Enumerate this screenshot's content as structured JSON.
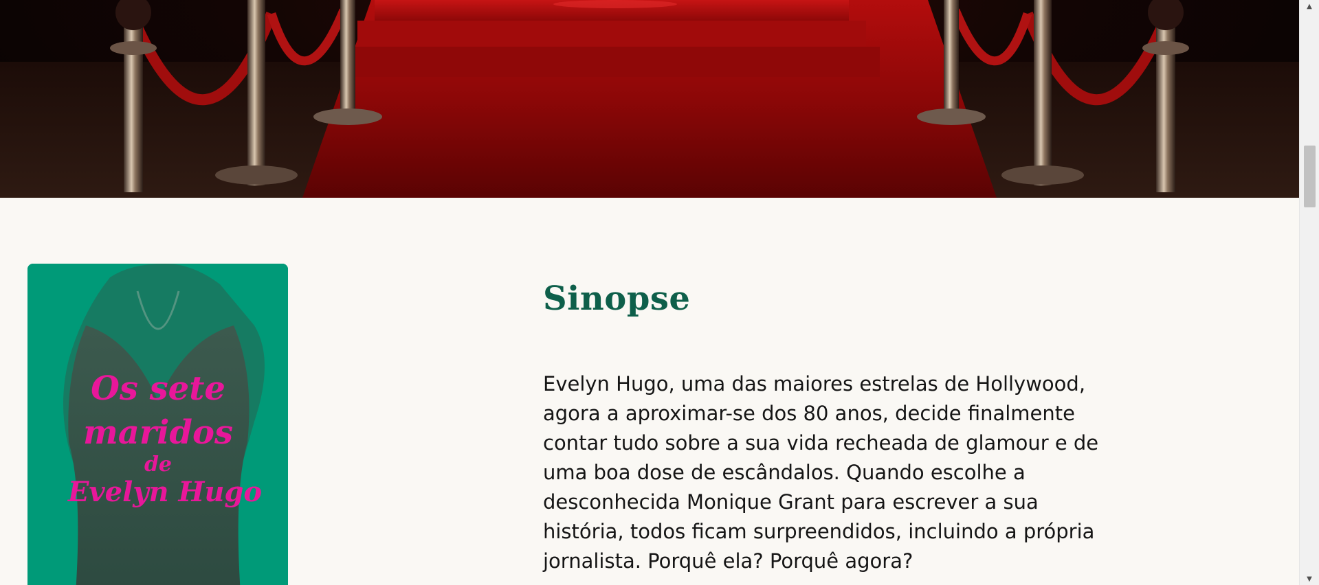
{
  "hero": {
    "image": "red-carpet-banner"
  },
  "book": {
    "cover_title_lines": [
      "Os sete",
      "maridos",
      "de",
      "Evelyn Hugo"
    ],
    "cover_color": "#009a78",
    "title_color": "#e8179a"
  },
  "synopsis": {
    "heading": "Sinopse",
    "body": "Evelyn Hugo, uma das maiores estrelas de Hollywood, agora a aproximar-se dos 80 anos, decide finalmente contar tudo sobre a sua vida recheada de glamour e de uma boa dose de escândalos. Quando escolhe a desconhecida Monique Grant para escrever a sua história, todos ficam surpreendidos, incluindo a própria jornalista. Porquê ela? Porquê agora?"
  },
  "colors": {
    "background": "#faf8f4",
    "heading": "#0e5f4a",
    "carpet": "#9c0a0a"
  }
}
